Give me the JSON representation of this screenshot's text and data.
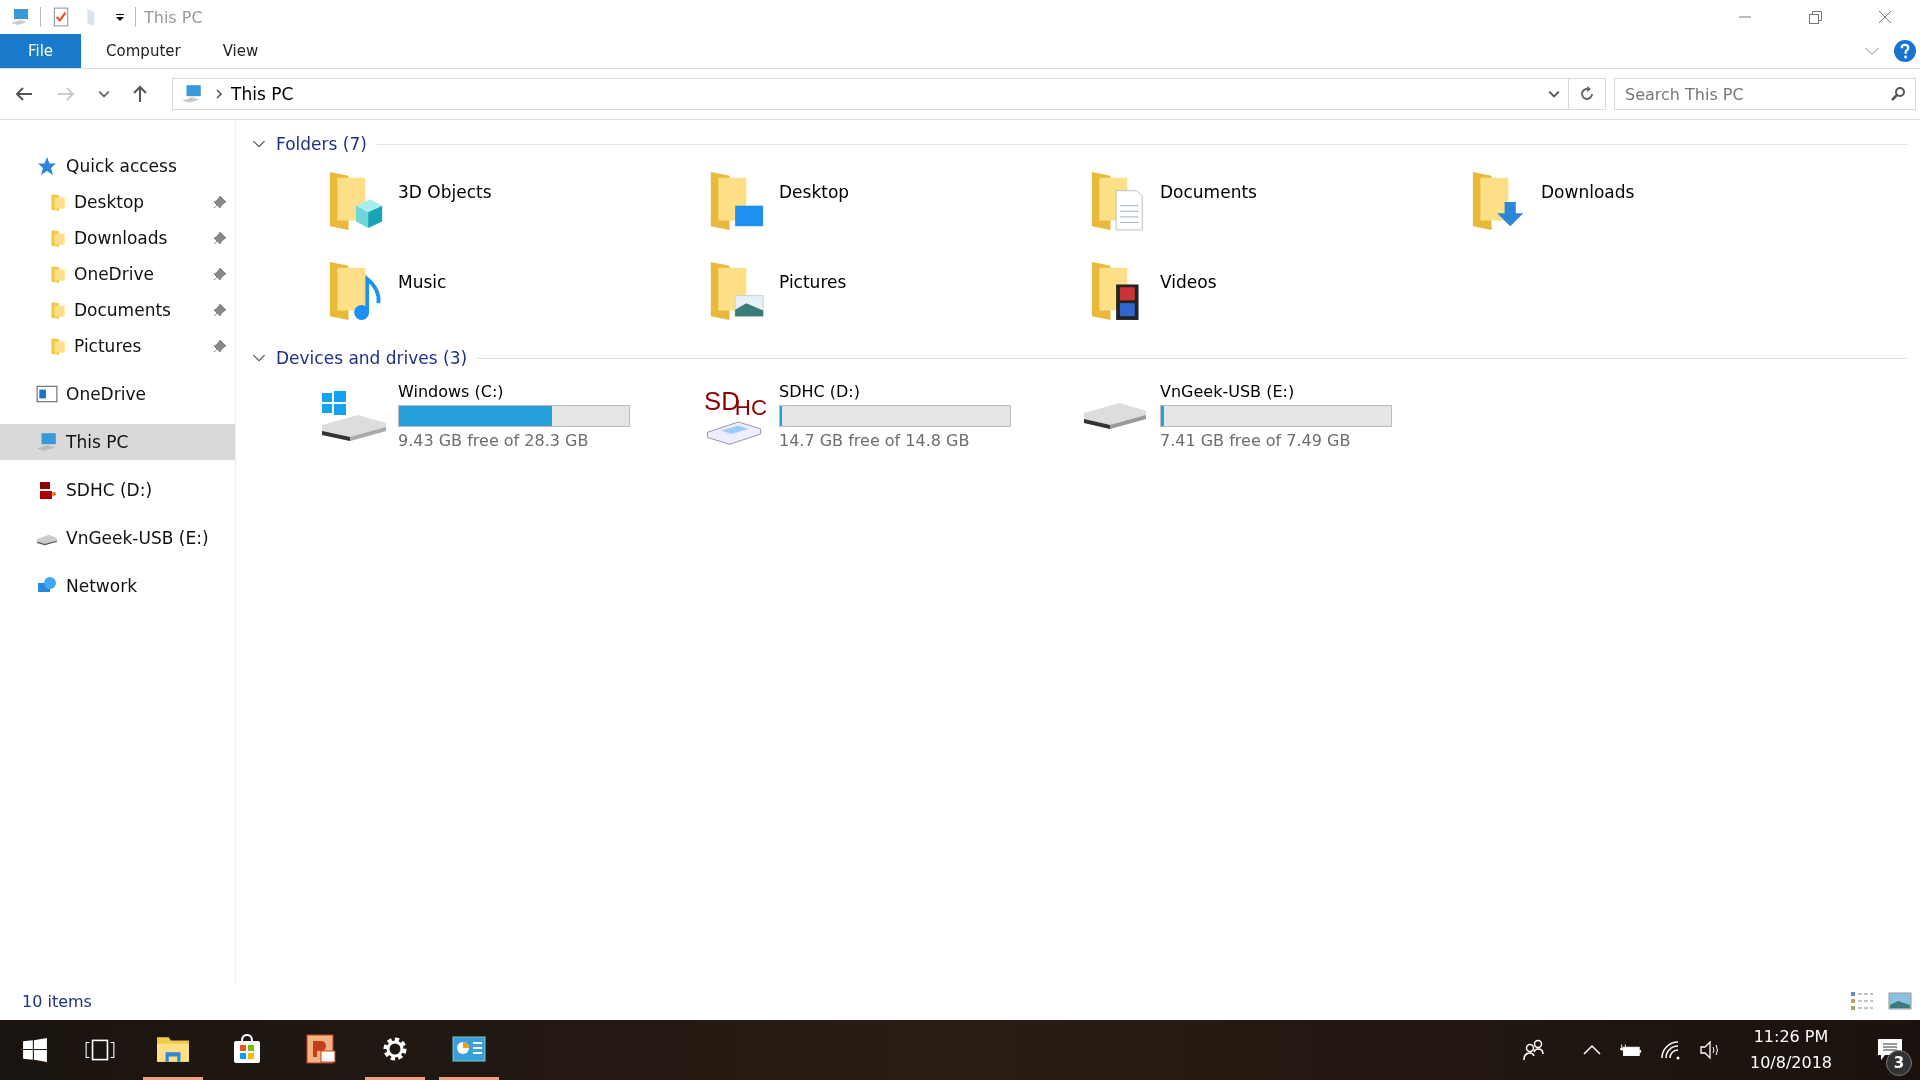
{
  "title_bar": {
    "title": "This PC"
  },
  "ribbon": {
    "tabs": [
      {
        "label": "File",
        "kind": "file",
        "selected": false
      },
      {
        "label": "Computer",
        "kind": "tab",
        "selected": false
      },
      {
        "label": "View",
        "kind": "tab",
        "selected": false
      }
    ]
  },
  "address": {
    "path": "This PC",
    "search_placeholder": "Search This PC"
  },
  "sidebar": {
    "items": [
      {
        "label": "Quick access",
        "kind": "star",
        "selected": false,
        "children": [
          {
            "label": "Desktop",
            "kind": "folder",
            "pinned": true,
            "selected": false
          },
          {
            "label": "Downloads",
            "kind": "folder",
            "pinned": true,
            "selected": false
          },
          {
            "label": "OneDrive",
            "kind": "folder",
            "pinned": true,
            "selected": false
          },
          {
            "label": "Documents",
            "kind": "folder",
            "pinned": true,
            "selected": false
          },
          {
            "label": "Pictures",
            "kind": "folder",
            "pinned": true,
            "selected": false
          }
        ]
      },
      {
        "label": "OneDrive",
        "kind": "window",
        "selected": false
      },
      {
        "label": "This PC",
        "kind": "pc",
        "selected": true
      },
      {
        "label": "SDHC (D:)",
        "kind": "sd",
        "selected": false
      },
      {
        "label": "VnGeek-USB (E:)",
        "kind": "usb",
        "selected": false
      },
      {
        "label": "Network",
        "kind": "network",
        "selected": false
      }
    ]
  },
  "sections": [
    {
      "title": "Folders (7)",
      "kind": "folders",
      "expanded": true,
      "items": [
        {
          "name": "3D Objects",
          "kind": "cube"
        },
        {
          "name": "Desktop",
          "kind": "desktop"
        },
        {
          "name": "Documents",
          "kind": "document"
        },
        {
          "name": "Downloads",
          "kind": "download"
        },
        {
          "name": "Music",
          "kind": "music"
        },
        {
          "name": "Pictures",
          "kind": "picture"
        },
        {
          "name": "Videos",
          "kind": "video"
        }
      ]
    },
    {
      "title": "Devices and drives (3)",
      "kind": "drives",
      "expanded": true,
      "items": [
        {
          "name": "Windows (C:)",
          "kind": "system",
          "level": 0.667,
          "free": "9.43 GB free of 28.3 GB"
        },
        {
          "name": "SDHC (D:)",
          "kind": "sd",
          "logo": [
            "SD",
            "HC"
          ],
          "level": 0.007,
          "free": "14.7 GB free of 14.8 GB"
        },
        {
          "name": "VnGeek-USB (E:)",
          "kind": "usb",
          "level": 0.011,
          "free": "7.41 GB free of 7.49 GB"
        }
      ]
    }
  ],
  "status_bar": {
    "count": "10 items"
  },
  "taskbar": {
    "apps": [
      {
        "kind": "explorer",
        "active": true
      },
      {
        "kind": "store",
        "active": false
      },
      {
        "kind": "powerpoint",
        "active": false
      },
      {
        "kind": "settings",
        "active": true
      },
      {
        "kind": "control",
        "active": true
      }
    ],
    "time": "11:26 PM",
    "date": "10/8/2018",
    "notifications": "3"
  }
}
